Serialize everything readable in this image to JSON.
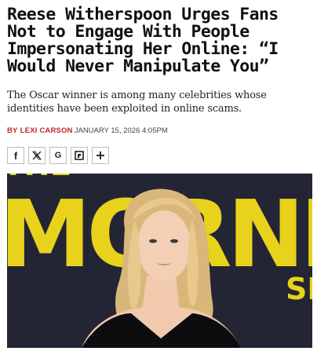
{
  "article": {
    "headline": "Reese Witherspoon Urges Fans Not to Engage With People Impersonating Her Online: “I Would Never Manipulate You”",
    "dek": "The Oscar winner is among many celebrities whose identities have been exploited in online scams.",
    "byline": {
      "prefix": "By",
      "author": "Lexi Carson",
      "date": "January 15, 2026 4:05pm"
    }
  },
  "share": [
    {
      "name": "facebook-icon",
      "label": "f"
    },
    {
      "name": "x-icon",
      "label": "𝕏"
    },
    {
      "name": "google-icon",
      "label": "G"
    },
    {
      "name": "flipboard-icon",
      "label": ""
    },
    {
      "name": "plus-icon",
      "label": "+"
    }
  ],
  "hero": {
    "backdrop_text": "THE MORNING SH",
    "colors": {
      "backdrop": "#232535",
      "letters": "#e9d21b",
      "dress": "#0d0d0f",
      "hair": "#e5c58a"
    }
  }
}
